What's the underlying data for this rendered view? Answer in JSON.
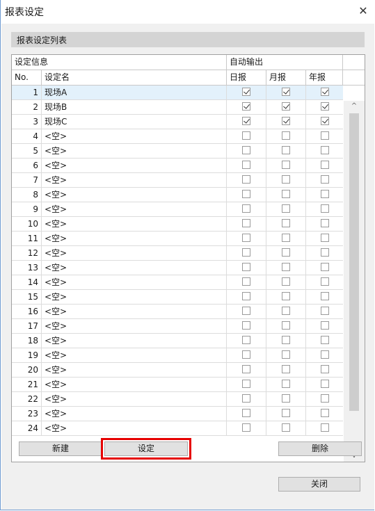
{
  "window": {
    "title": "报表设定",
    "close_glyph": "✕"
  },
  "section": {
    "label": "报表设定列表"
  },
  "table": {
    "group_info": "设定信息",
    "group_auto": "自动输出",
    "col_no": "No.",
    "col_name": "设定名",
    "col_daily": "日报",
    "col_monthly": "月报",
    "col_yearly": "年报",
    "rows": [
      {
        "no": "1",
        "name": "现场A",
        "d": true,
        "m": true,
        "y": true
      },
      {
        "no": "2",
        "name": "现场B",
        "d": true,
        "m": true,
        "y": true
      },
      {
        "no": "3",
        "name": "现场C",
        "d": true,
        "m": true,
        "y": true
      },
      {
        "no": "4",
        "name": "<空>",
        "d": false,
        "m": false,
        "y": false
      },
      {
        "no": "5",
        "name": "<空>",
        "d": false,
        "m": false,
        "y": false
      },
      {
        "no": "6",
        "name": "<空>",
        "d": false,
        "m": false,
        "y": false
      },
      {
        "no": "7",
        "name": "<空>",
        "d": false,
        "m": false,
        "y": false
      },
      {
        "no": "8",
        "name": "<空>",
        "d": false,
        "m": false,
        "y": false
      },
      {
        "no": "9",
        "name": "<空>",
        "d": false,
        "m": false,
        "y": false
      },
      {
        "no": "10",
        "name": "<空>",
        "d": false,
        "m": false,
        "y": false
      },
      {
        "no": "11",
        "name": "<空>",
        "d": false,
        "m": false,
        "y": false
      },
      {
        "no": "12",
        "name": "<空>",
        "d": false,
        "m": false,
        "y": false
      },
      {
        "no": "13",
        "name": "<空>",
        "d": false,
        "m": false,
        "y": false
      },
      {
        "no": "14",
        "name": "<空>",
        "d": false,
        "m": false,
        "y": false
      },
      {
        "no": "15",
        "name": "<空>",
        "d": false,
        "m": false,
        "y": false
      },
      {
        "no": "16",
        "name": "<空>",
        "d": false,
        "m": false,
        "y": false
      },
      {
        "no": "17",
        "name": "<空>",
        "d": false,
        "m": false,
        "y": false
      },
      {
        "no": "18",
        "name": "<空>",
        "d": false,
        "m": false,
        "y": false
      },
      {
        "no": "19",
        "name": "<空>",
        "d": false,
        "m": false,
        "y": false
      },
      {
        "no": "20",
        "name": "<空>",
        "d": false,
        "m": false,
        "y": false
      },
      {
        "no": "21",
        "name": "<空>",
        "d": false,
        "m": false,
        "y": false
      },
      {
        "no": "22",
        "name": "<空>",
        "d": false,
        "m": false,
        "y": false
      },
      {
        "no": "23",
        "name": "<空>",
        "d": false,
        "m": false,
        "y": false
      },
      {
        "no": "24",
        "name": "<空>",
        "d": false,
        "m": false,
        "y": false
      }
    ]
  },
  "scrollbar": {
    "up_glyph": "^",
    "down_glyph": "v"
  },
  "buttons": {
    "new": "新建",
    "setting": "设定",
    "delete": "删除",
    "close": "关闭"
  },
  "colors": {
    "selected_row": "#e3f1fb",
    "highlight": "#e60000"
  }
}
